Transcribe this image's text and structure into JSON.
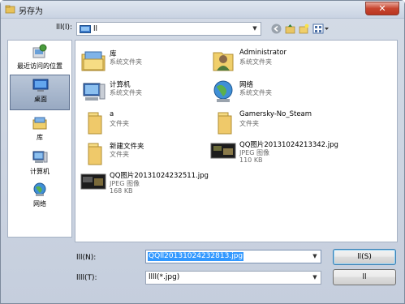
{
  "window": {
    "title": "另存为",
    "close_label": "✕"
  },
  "lookin": {
    "label": "lll(l):",
    "value": "ll"
  },
  "places": [
    {
      "label": "最近访问的位置",
      "icon": "recent-places-icon"
    },
    {
      "label": "桌面",
      "icon": "desktop-icon",
      "active": true
    },
    {
      "label": "库",
      "icon": "library-icon"
    },
    {
      "label": "计算机",
      "icon": "computer-icon"
    },
    {
      "label": "网络",
      "icon": "network-icon"
    }
  ],
  "files": [
    {
      "name": "库",
      "sub": "系统文件夹",
      "sub2": "",
      "icon": "library-folder-icon"
    },
    {
      "name": "Administrator",
      "sub": "系统文件夹",
      "sub2": "",
      "icon": "user-folder-icon"
    },
    {
      "name": "计算机",
      "sub": "系统文件夹",
      "sub2": "",
      "icon": "computer-icon"
    },
    {
      "name": "网络",
      "sub": "系统文件夹",
      "sub2": "",
      "icon": "network-globe-icon"
    },
    {
      "name": "a",
      "sub": "文件夹",
      "sub2": "",
      "icon": "folder-icon"
    },
    {
      "name": "Gamersky-No_Steam",
      "sub": "文件夹",
      "sub2": "",
      "icon": "folder-icon"
    },
    {
      "name": "新建文件夹",
      "sub": "文件夹",
      "sub2": "",
      "icon": "folder-icon"
    },
    {
      "name": "QQ图片20131024213342.jpg",
      "sub": "JPEG 图像",
      "sub2": "110 KB",
      "icon": "image-thumbnail-icon"
    },
    {
      "name": "QQ图片20131024232511.jpg",
      "sub": "JPEG 图像",
      "sub2": "168 KB",
      "icon": "image-thumbnail-icon"
    }
  ],
  "form": {
    "filename_label": "lll(N):",
    "filename_value": "QQll20131024232813.jpg",
    "type_label": "llll(T):",
    "type_value": "llll(*.jpg)",
    "save_label": "ll(S)",
    "cancel_label": "ll"
  },
  "colors": {
    "selection": "#3399ff",
    "close": "#c7452f"
  }
}
